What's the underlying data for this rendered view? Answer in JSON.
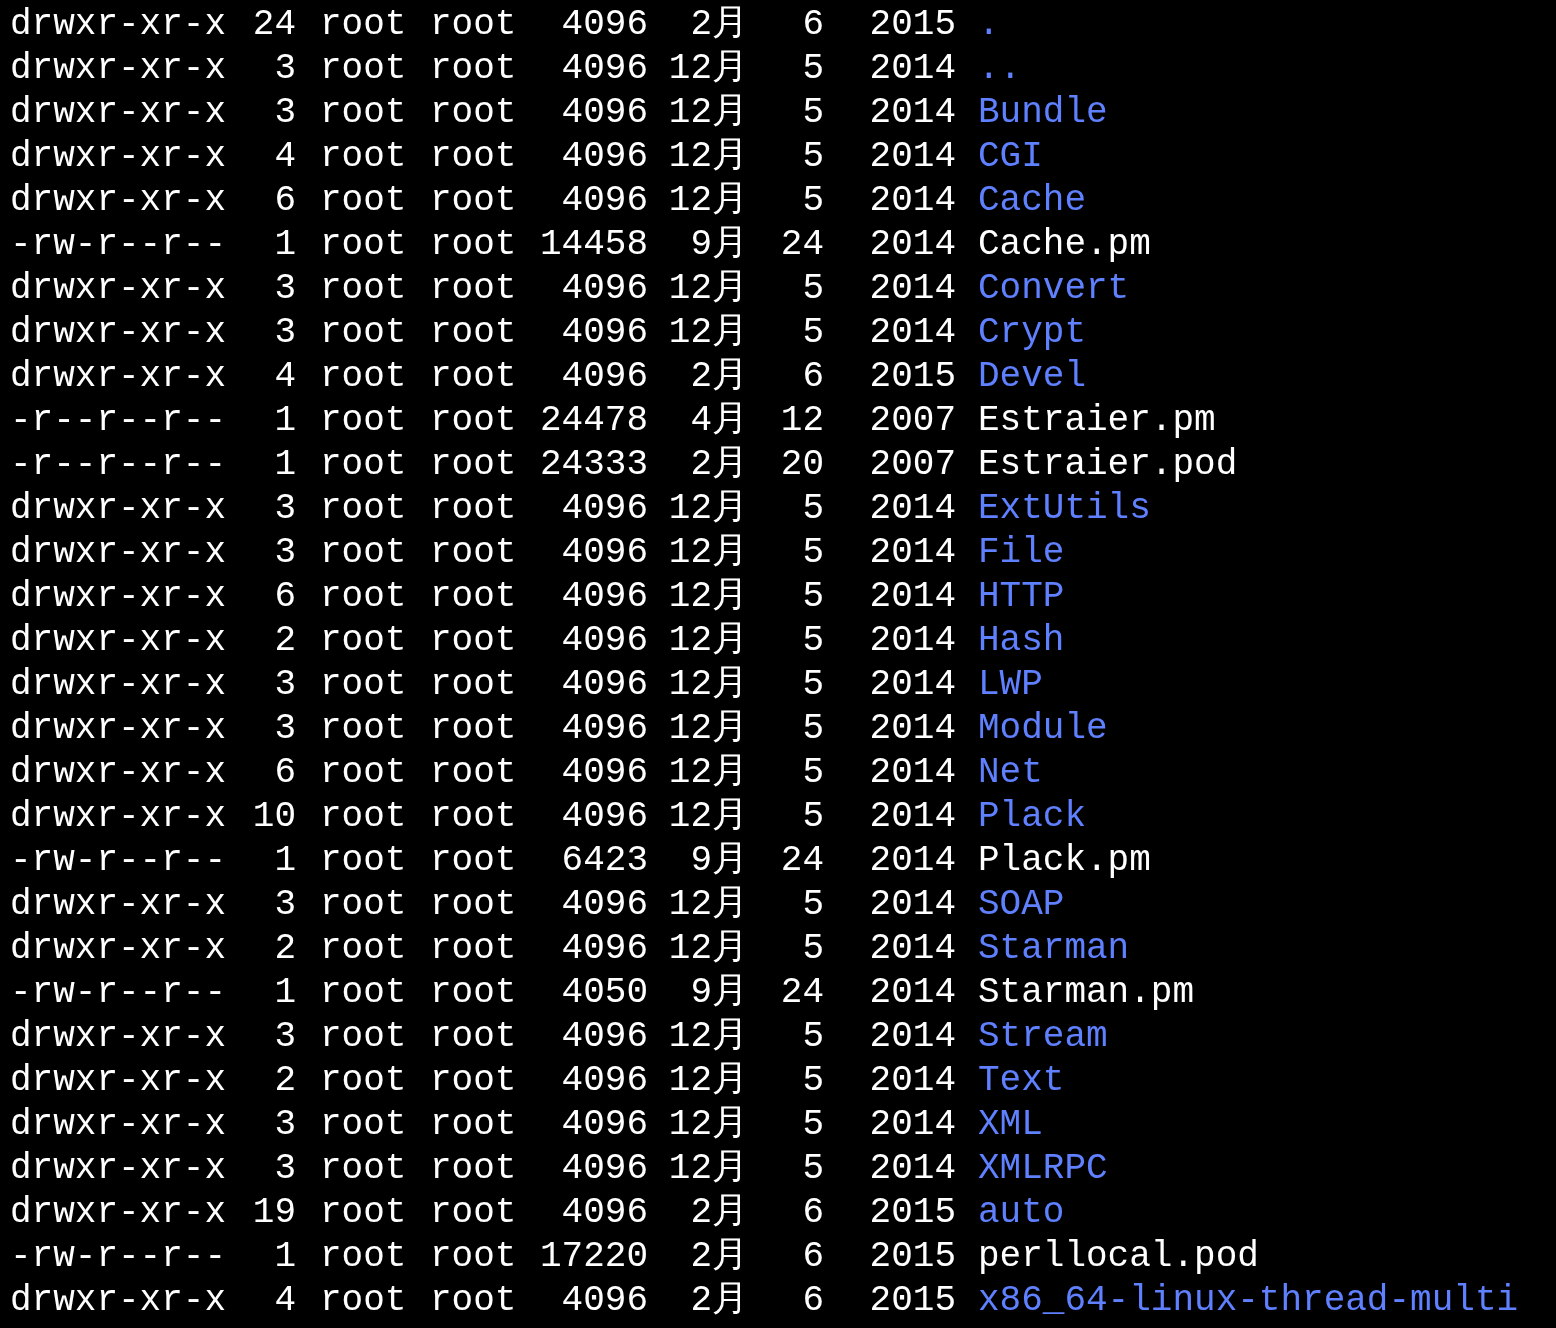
{
  "listing": [
    {
      "perms": "drwxr-xr-x",
      "links": "24",
      "owner": "root",
      "group": "root",
      "size": "4096",
      "month": "2月",
      "day": "6",
      "year": "2015",
      "name": ".",
      "kind": "dir"
    },
    {
      "perms": "drwxr-xr-x",
      "links": "3",
      "owner": "root",
      "group": "root",
      "size": "4096",
      "month": "12月",
      "day": "5",
      "year": "2014",
      "name": "..",
      "kind": "dir"
    },
    {
      "perms": "drwxr-xr-x",
      "links": "3",
      "owner": "root",
      "group": "root",
      "size": "4096",
      "month": "12月",
      "day": "5",
      "year": "2014",
      "name": "Bundle",
      "kind": "dir"
    },
    {
      "perms": "drwxr-xr-x",
      "links": "4",
      "owner": "root",
      "group": "root",
      "size": "4096",
      "month": "12月",
      "day": "5",
      "year": "2014",
      "name": "CGI",
      "kind": "dir"
    },
    {
      "perms": "drwxr-xr-x",
      "links": "6",
      "owner": "root",
      "group": "root",
      "size": "4096",
      "month": "12月",
      "day": "5",
      "year": "2014",
      "name": "Cache",
      "kind": "dir"
    },
    {
      "perms": "-rw-r--r--",
      "links": "1",
      "owner": "root",
      "group": "root",
      "size": "14458",
      "month": "9月",
      "day": "24",
      "year": "2014",
      "name": "Cache.pm",
      "kind": "file"
    },
    {
      "perms": "drwxr-xr-x",
      "links": "3",
      "owner": "root",
      "group": "root",
      "size": "4096",
      "month": "12月",
      "day": "5",
      "year": "2014",
      "name": "Convert",
      "kind": "dir"
    },
    {
      "perms": "drwxr-xr-x",
      "links": "3",
      "owner": "root",
      "group": "root",
      "size": "4096",
      "month": "12月",
      "day": "5",
      "year": "2014",
      "name": "Crypt",
      "kind": "dir"
    },
    {
      "perms": "drwxr-xr-x",
      "links": "4",
      "owner": "root",
      "group": "root",
      "size": "4096",
      "month": "2月",
      "day": "6",
      "year": "2015",
      "name": "Devel",
      "kind": "dir"
    },
    {
      "perms": "-r--r--r--",
      "links": "1",
      "owner": "root",
      "group": "root",
      "size": "24478",
      "month": "4月",
      "day": "12",
      "year": "2007",
      "name": "Estraier.pm",
      "kind": "file"
    },
    {
      "perms": "-r--r--r--",
      "links": "1",
      "owner": "root",
      "group": "root",
      "size": "24333",
      "month": "2月",
      "day": "20",
      "year": "2007",
      "name": "Estraier.pod",
      "kind": "file"
    },
    {
      "perms": "drwxr-xr-x",
      "links": "3",
      "owner": "root",
      "group": "root",
      "size": "4096",
      "month": "12月",
      "day": "5",
      "year": "2014",
      "name": "ExtUtils",
      "kind": "dir"
    },
    {
      "perms": "drwxr-xr-x",
      "links": "3",
      "owner": "root",
      "group": "root",
      "size": "4096",
      "month": "12月",
      "day": "5",
      "year": "2014",
      "name": "File",
      "kind": "dir"
    },
    {
      "perms": "drwxr-xr-x",
      "links": "6",
      "owner": "root",
      "group": "root",
      "size": "4096",
      "month": "12月",
      "day": "5",
      "year": "2014",
      "name": "HTTP",
      "kind": "dir"
    },
    {
      "perms": "drwxr-xr-x",
      "links": "2",
      "owner": "root",
      "group": "root",
      "size": "4096",
      "month": "12月",
      "day": "5",
      "year": "2014",
      "name": "Hash",
      "kind": "dir"
    },
    {
      "perms": "drwxr-xr-x",
      "links": "3",
      "owner": "root",
      "group": "root",
      "size": "4096",
      "month": "12月",
      "day": "5",
      "year": "2014",
      "name": "LWP",
      "kind": "dir"
    },
    {
      "perms": "drwxr-xr-x",
      "links": "3",
      "owner": "root",
      "group": "root",
      "size": "4096",
      "month": "12月",
      "day": "5",
      "year": "2014",
      "name": "Module",
      "kind": "dir"
    },
    {
      "perms": "drwxr-xr-x",
      "links": "6",
      "owner": "root",
      "group": "root",
      "size": "4096",
      "month": "12月",
      "day": "5",
      "year": "2014",
      "name": "Net",
      "kind": "dir"
    },
    {
      "perms": "drwxr-xr-x",
      "links": "10",
      "owner": "root",
      "group": "root",
      "size": "4096",
      "month": "12月",
      "day": "5",
      "year": "2014",
      "name": "Plack",
      "kind": "dir"
    },
    {
      "perms": "-rw-r--r--",
      "links": "1",
      "owner": "root",
      "group": "root",
      "size": "6423",
      "month": "9月",
      "day": "24",
      "year": "2014",
      "name": "Plack.pm",
      "kind": "file"
    },
    {
      "perms": "drwxr-xr-x",
      "links": "3",
      "owner": "root",
      "group": "root",
      "size": "4096",
      "month": "12月",
      "day": "5",
      "year": "2014",
      "name": "SOAP",
      "kind": "dir"
    },
    {
      "perms": "drwxr-xr-x",
      "links": "2",
      "owner": "root",
      "group": "root",
      "size": "4096",
      "month": "12月",
      "day": "5",
      "year": "2014",
      "name": "Starman",
      "kind": "dir"
    },
    {
      "perms": "-rw-r--r--",
      "links": "1",
      "owner": "root",
      "group": "root",
      "size": "4050",
      "month": "9月",
      "day": "24",
      "year": "2014",
      "name": "Starman.pm",
      "kind": "file"
    },
    {
      "perms": "drwxr-xr-x",
      "links": "3",
      "owner": "root",
      "group": "root",
      "size": "4096",
      "month": "12月",
      "day": "5",
      "year": "2014",
      "name": "Stream",
      "kind": "dir"
    },
    {
      "perms": "drwxr-xr-x",
      "links": "2",
      "owner": "root",
      "group": "root",
      "size": "4096",
      "month": "12月",
      "day": "5",
      "year": "2014",
      "name": "Text",
      "kind": "dir"
    },
    {
      "perms": "drwxr-xr-x",
      "links": "3",
      "owner": "root",
      "group": "root",
      "size": "4096",
      "month": "12月",
      "day": "5",
      "year": "2014",
      "name": "XML",
      "kind": "dir"
    },
    {
      "perms": "drwxr-xr-x",
      "links": "3",
      "owner": "root",
      "group": "root",
      "size": "4096",
      "month": "12月",
      "day": "5",
      "year": "2014",
      "name": "XMLRPC",
      "kind": "dir"
    },
    {
      "perms": "drwxr-xr-x",
      "links": "19",
      "owner": "root",
      "group": "root",
      "size": "4096",
      "month": "2月",
      "day": "6",
      "year": "2015",
      "name": "auto",
      "kind": "dir"
    },
    {
      "perms": "-rw-r--r--",
      "links": "1",
      "owner": "root",
      "group": "root",
      "size": "17220",
      "month": "2月",
      "day": "6",
      "year": "2015",
      "name": "perllocal.pod",
      "kind": "file"
    },
    {
      "perms": "drwxr-xr-x",
      "links": "4",
      "owner": "root",
      "group": "root",
      "size": "4096",
      "month": "2月",
      "day": "6",
      "year": "2015",
      "name": "x86_64-linux-thread-multi",
      "kind": "dir"
    }
  ]
}
